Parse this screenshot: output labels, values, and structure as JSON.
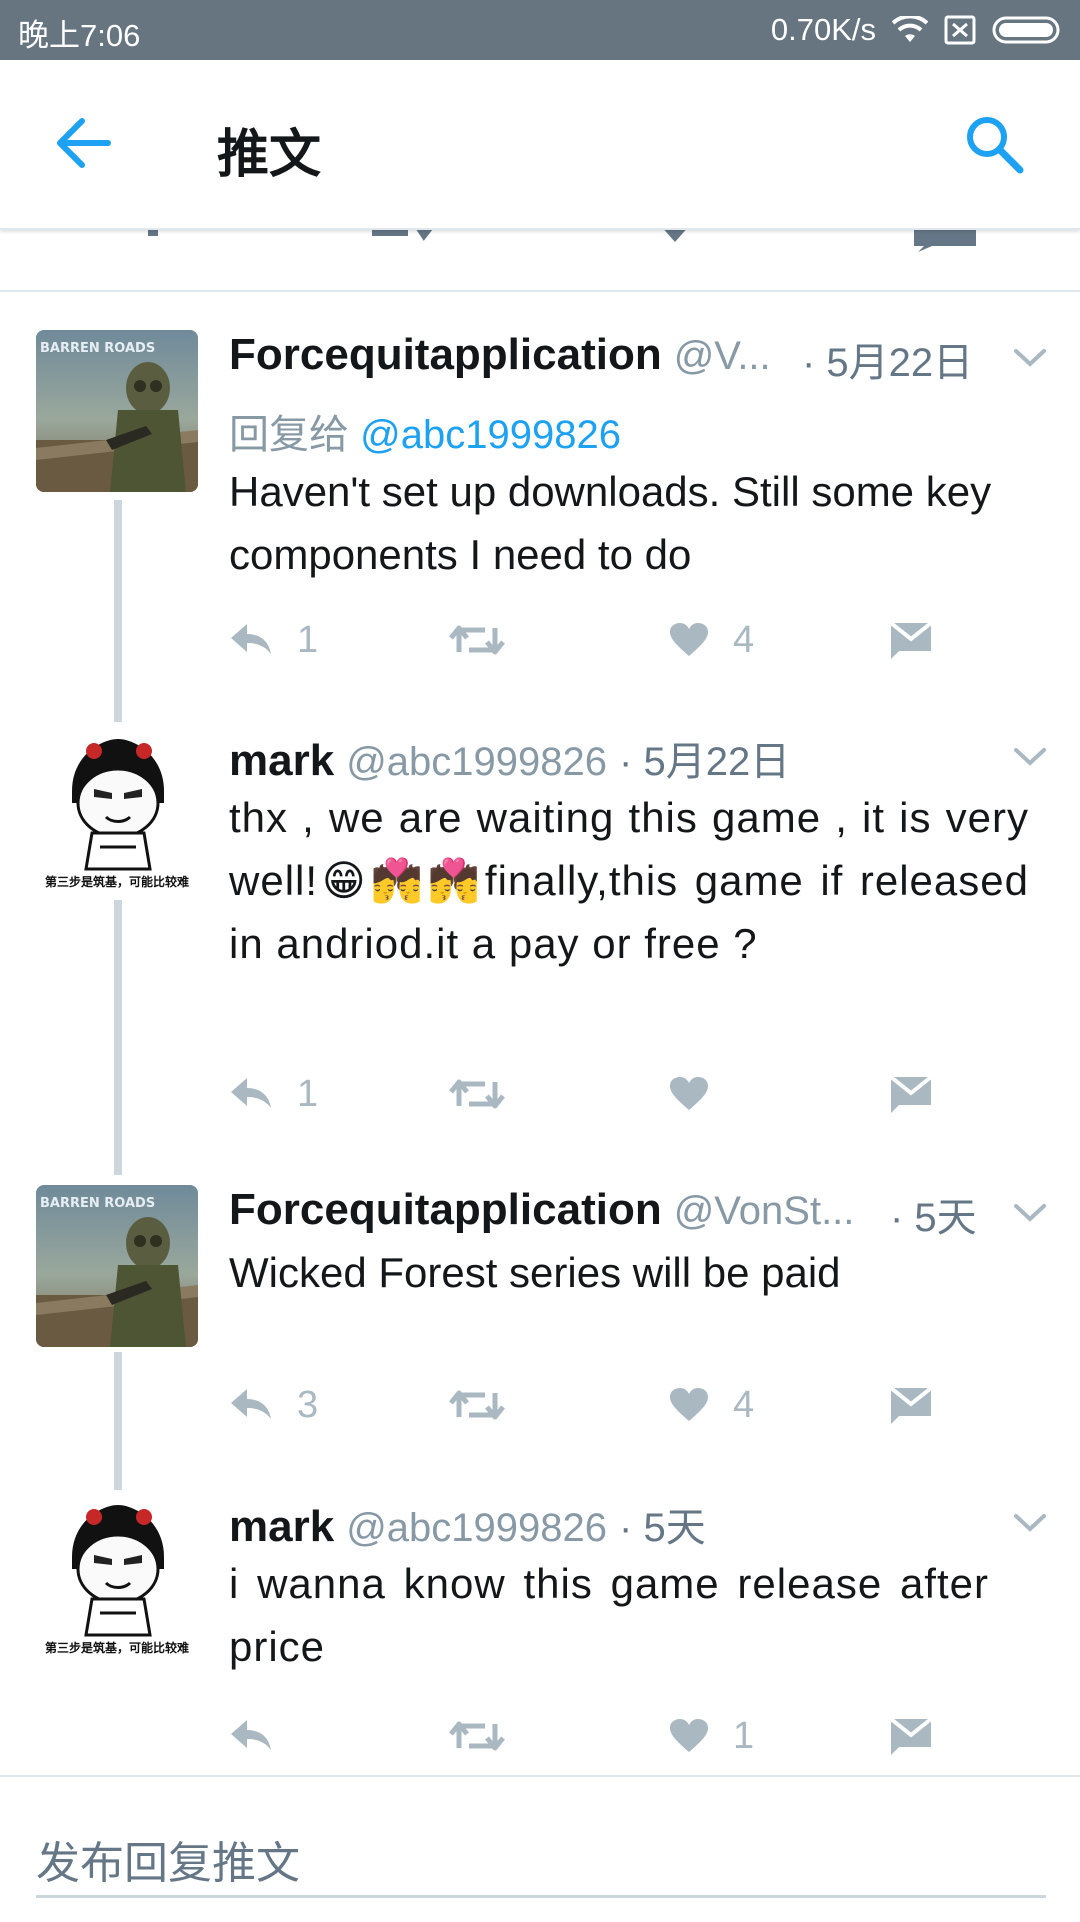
{
  "status_bar": {
    "time": "晚上7:06",
    "speed": "0.70K/s"
  },
  "header": {
    "title": "推文"
  },
  "tweets": [
    {
      "name": "Forcequitapplication",
      "handle": "@V...",
      "date": "· 5月22日",
      "reply_prefix": "回复给",
      "reply_mention": "@abc1999826",
      "text": "Haven't set up downloads. Still some key components I need to do",
      "replies": "1",
      "likes": "4"
    },
    {
      "name": "mark",
      "handle": "@abc1999826",
      "date": "· 5月22日",
      "text": "thx , we are waiting this game , it is very well!😁💏💏finally,this game if released in andriod.it a  pay or free ?",
      "replies": "1",
      "likes": ""
    },
    {
      "name": "Forcequitapplication",
      "handle": "@VonSt...",
      "date": "· 5天",
      "text": "Wicked Forest series will be paid",
      "replies": "3",
      "likes": "4"
    },
    {
      "name": "mark",
      "handle": "@abc1999826",
      "date": "· 5天",
      "text": "i wanna know  this game release after price",
      "replies": "",
      "likes": "1"
    }
  ],
  "avatars": {
    "barren_roads_text": "BARREN ROADS",
    "meme_caption": "第三步是筑基，可能比较难"
  },
  "composer": {
    "placeholder": "发布回复推文"
  },
  "colors": {
    "status_bar": "#66757f",
    "accent": "#1da1f2",
    "icon_gray": "#aab8c2",
    "thread_line": "#ccd6dd"
  }
}
